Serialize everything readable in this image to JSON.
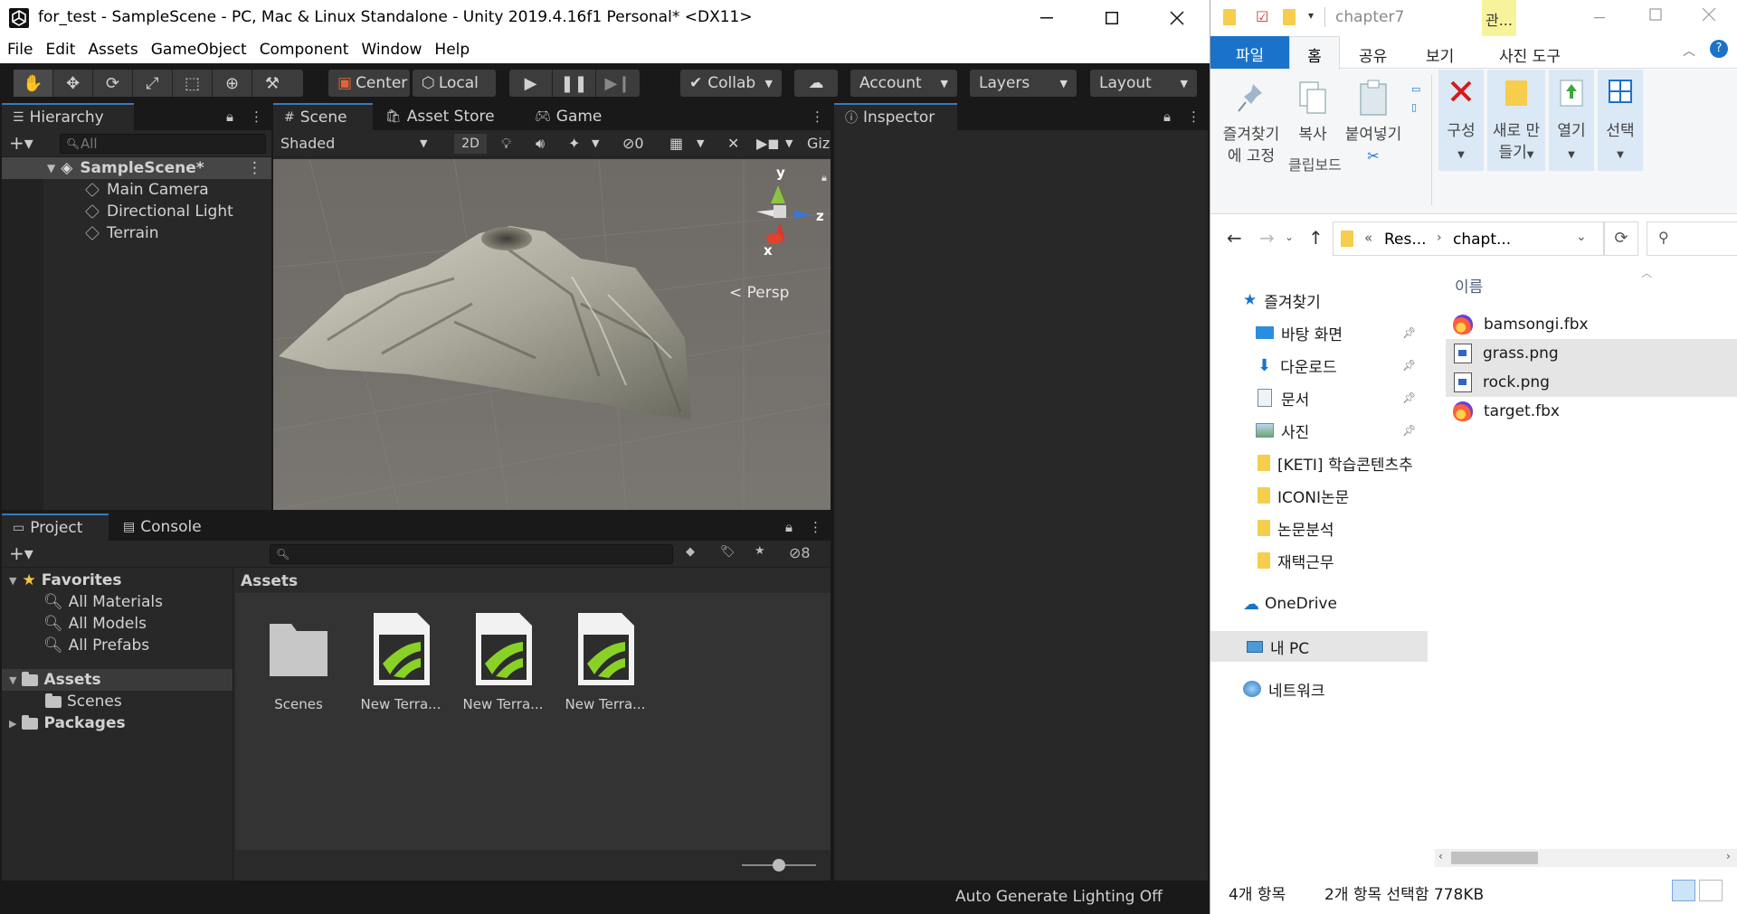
{
  "unity": {
    "window_title": "for_test - SampleScene - PC, Mac & Linux Standalone - Unity 2019.4.16f1 Personal* <DX11>",
    "menu": [
      "File",
      "Edit",
      "Assets",
      "GameObject",
      "Component",
      "Window",
      "Help"
    ],
    "toolbar": {
      "pivot": "Center",
      "space": "Local",
      "collab": "Collab",
      "account": "Account",
      "layers": "Layers",
      "layout": "Layout"
    },
    "hierarchy": {
      "tab": "Hierarchy",
      "search_placeholder": "All",
      "scene": "SampleScene*",
      "objects": [
        "Main Camera",
        "Directional Light",
        "Terrain"
      ]
    },
    "scene_view": {
      "tabs": [
        "Scene",
        "Asset Store",
        "Game"
      ],
      "shading": "Shaded",
      "mode_2d": "2D",
      "hidden_count": "0",
      "gizmos": "Giz",
      "axis_y": "y",
      "axis_x": "x",
      "axis_z": "z",
      "projection": "Persp"
    },
    "inspector": {
      "tab": "Inspector"
    },
    "project": {
      "tabs": [
        "Project",
        "Console"
      ],
      "hidden_count": "8",
      "favorites_label": "Favorites",
      "favorites": [
        "All Materials",
        "All Models",
        "All Prefabs"
      ],
      "assets_label": "Assets",
      "assets_children": [
        "Scenes"
      ],
      "packages_label": "Packages",
      "breadcrumb": "Assets",
      "items": [
        {
          "name": "Scenes",
          "kind": "folder"
        },
        {
          "name": "New Terra...",
          "kind": "terrain"
        },
        {
          "name": "New Terra...",
          "kind": "terrain"
        },
        {
          "name": "New Terra...",
          "kind": "terrain"
        }
      ]
    },
    "status": "Auto Generate Lighting Off"
  },
  "explorer": {
    "title_path": "chapter7",
    "context_tab": "관...",
    "ribbon_tabs": [
      "파일",
      "홈",
      "공유",
      "보기",
      "사진 도구"
    ],
    "ribbon": {
      "pin": "즐겨찾기에 고정",
      "copy": "복사",
      "paste": "붙여넣기",
      "clipboard_group": "클립보드",
      "organize": "구성",
      "new": "새로 만들기",
      "open": "열기",
      "select": "선택"
    },
    "address": {
      "part1": "Res...",
      "part2": "chapt..."
    },
    "column_header": "이름",
    "nav": {
      "quick_access": "즐겨찾기",
      "quick_items": [
        "바탕 화면",
        "다운로드",
        "문서",
        "사진"
      ],
      "folders": [
        "[KETI] 학습콘텐츠추",
        "ICONI논문",
        "논문분석",
        "재택근무"
      ],
      "onedrive": "OneDrive",
      "this_pc": "내 PC",
      "network": "네트워크"
    },
    "files": [
      {
        "name": "bamsongi.fbx",
        "type": "fbx",
        "selected": false
      },
      {
        "name": "grass.png",
        "type": "png",
        "selected": true
      },
      {
        "name": "rock.png",
        "type": "png",
        "selected": true
      },
      {
        "name": "target.fbx",
        "type": "fbx",
        "selected": false
      }
    ],
    "status": {
      "count": "4개 항목",
      "selection": "2개 항목 선택함 778KB"
    }
  }
}
